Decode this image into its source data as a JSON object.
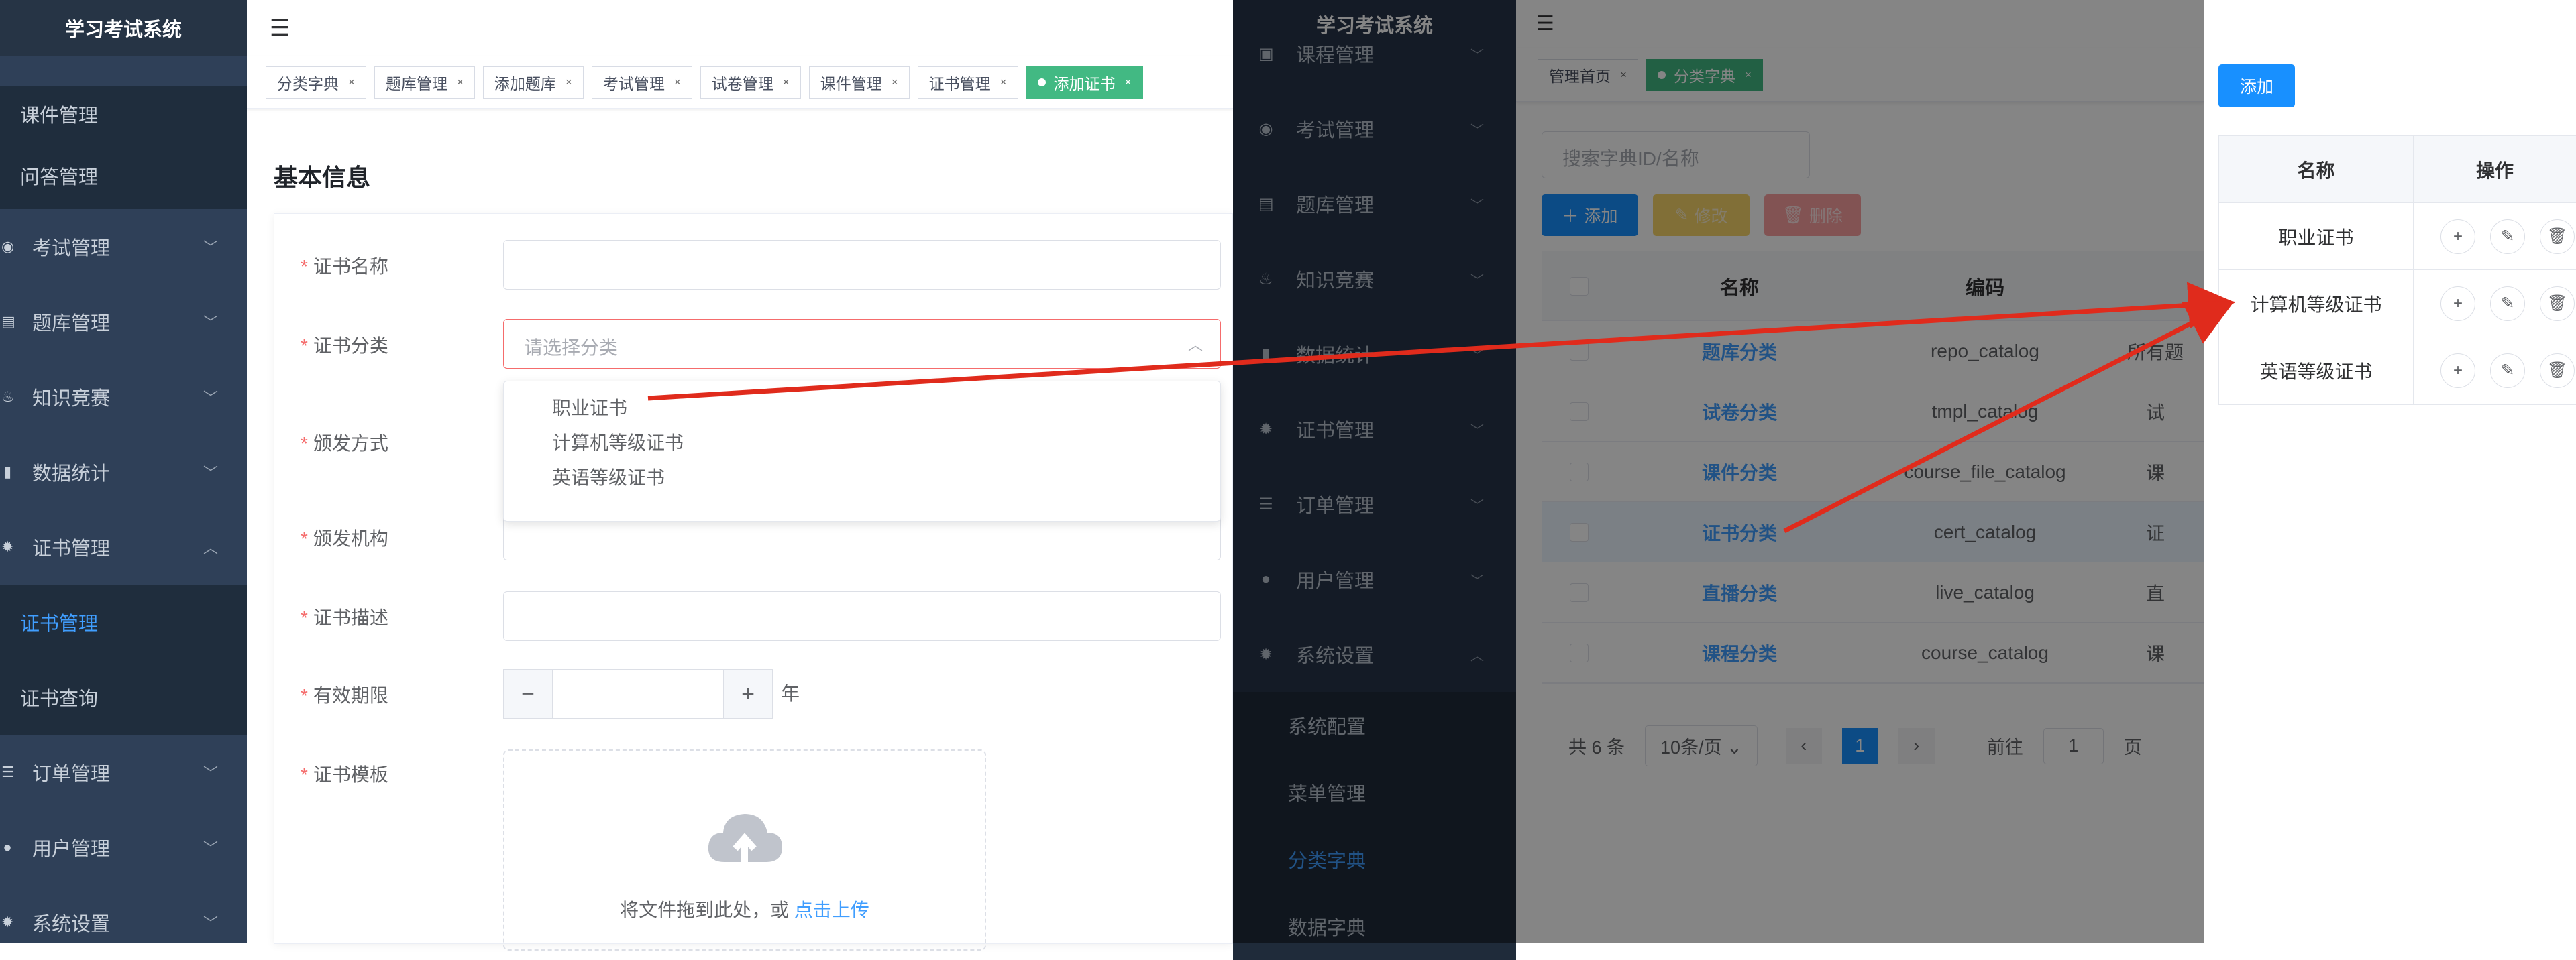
{
  "win1": {
    "brand": "学习考试系统",
    "sidebar": [
      {
        "label": "课件管理",
        "icon": "",
        "chev": false,
        "sub": true,
        "active": false
      },
      {
        "label": "问答管理",
        "icon": "",
        "chev": false,
        "sub": true,
        "active": false
      },
      {
        "label": "考试管理",
        "icon": "exam-icon",
        "chev": true,
        "sub": false,
        "active": false
      },
      {
        "label": "题库管理",
        "icon": "repo-icon",
        "chev": true,
        "sub": false,
        "active": false
      },
      {
        "label": "知识竞赛",
        "icon": "fire-icon",
        "chev": true,
        "sub": false,
        "active": false
      },
      {
        "label": "数据统计",
        "icon": "chart-icon",
        "chev": true,
        "sub": false,
        "active": false
      },
      {
        "label": "证书管理",
        "icon": "gear-icon",
        "chev": true,
        "up": true,
        "sub": false,
        "active": false
      },
      {
        "label": "证书管理",
        "icon": "",
        "chev": false,
        "sub": true,
        "active": true
      },
      {
        "label": "证书查询",
        "icon": "",
        "chev": false,
        "sub": true,
        "active": false
      },
      {
        "label": "订单管理",
        "icon": "list-icon",
        "chev": true,
        "sub": false,
        "active": false
      },
      {
        "label": "用户管理",
        "icon": "user-icon",
        "chev": true,
        "sub": false,
        "active": false
      },
      {
        "label": "系统设置",
        "icon": "gear-icon",
        "chev": true,
        "sub": false,
        "active": false
      }
    ],
    "tabs": [
      "分类字典",
      "题库管理",
      "添加题库",
      "考试管理",
      "试卷管理",
      "课件管理",
      "证书管理",
      "添加证书"
    ],
    "section_title": "基本信息",
    "fields": {
      "name": "证书名称",
      "category": "证书分类",
      "category_placeholder": "请选择分类",
      "issue_method": "颁发方式",
      "issuer": "颁发机构",
      "description": "证书描述",
      "validity": "有效期限",
      "validity_unit": "年",
      "template": "证书模板"
    },
    "dropdown_options": [
      "职业证书",
      "计算机等级证书",
      "英语等级证书"
    ],
    "upload_text": "将文件拖到此处，或",
    "upload_link": "点击上传"
  },
  "win2": {
    "brand": "学习考试系统",
    "sidebar": [
      {
        "label": "课程管理",
        "icon": "book-icon"
      },
      {
        "label": "考试管理",
        "icon": "exam-icon"
      },
      {
        "label": "题库管理",
        "icon": "repo-icon"
      },
      {
        "label": "知识竞赛",
        "icon": "fire-icon"
      },
      {
        "label": "数据统计",
        "icon": "chart-icon"
      },
      {
        "label": "证书管理",
        "icon": "gear-icon"
      },
      {
        "label": "订单管理",
        "icon": "list-icon"
      },
      {
        "label": "用户管理",
        "icon": "user-icon"
      },
      {
        "label": "系统设置",
        "icon": "gear-icon"
      }
    ],
    "submenu": [
      "系统配置",
      "菜单管理",
      "分类字典",
      "数据字典"
    ],
    "tabs": [
      "管理首页",
      "分类字典"
    ],
    "search_placeholder": "搜索字典ID/名称",
    "btn_add": "添加",
    "btn_edit": "修改",
    "btn_delete": "删除",
    "columns": [
      "名称",
      "编码"
    ],
    "rows": [
      {
        "name": "题库分类",
        "code": "repo_catalog",
        "extra": "所有题"
      },
      {
        "name": "试卷分类",
        "code": "tmpl_catalog",
        "extra": "试"
      },
      {
        "name": "课件分类",
        "code": "course_file_catalog",
        "extra": "课"
      },
      {
        "name": "证书分类",
        "code": "cert_catalog",
        "extra": "证"
      },
      {
        "name": "直播分类",
        "code": "live_catalog",
        "extra": "直"
      },
      {
        "name": "课程分类",
        "code": "course_catalog",
        "extra": "课"
      }
    ],
    "pager": {
      "total": "共 6 条",
      "size": "10条/页",
      "page": "1",
      "goto": "前往",
      "goto_value": "1",
      "unit": "页"
    }
  },
  "win3": {
    "btn_add": "添加",
    "col_name": "名称",
    "col_action": "操作",
    "rows": [
      "职业证书",
      "计算机等级证书",
      "英语等级证书"
    ]
  },
  "colors": {
    "sidebar": "#2f4058",
    "accent": "#409eff",
    "tag_active": "#42b983",
    "arrow": "#e02b1c",
    "danger": "#f56c6c"
  }
}
